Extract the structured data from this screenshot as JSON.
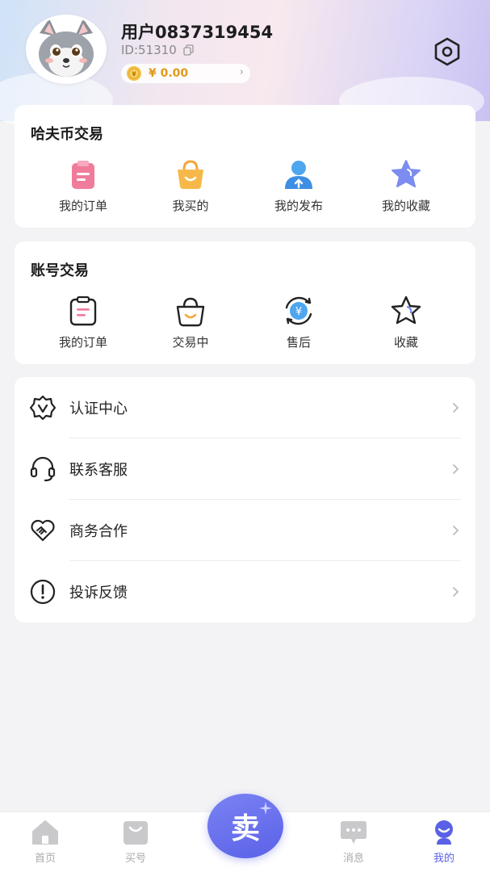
{
  "profile": {
    "username": "用户0837319454",
    "id_text": "ID:51310",
    "balance": "¥ 0.00"
  },
  "hafu_section": {
    "title": "哈夫币交易",
    "items": [
      {
        "label": "我的订单",
        "icon": "pink-clipboard-icon"
      },
      {
        "label": "我买的",
        "icon": "orange-bag-icon"
      },
      {
        "label": "我的发布",
        "icon": "blue-user-upload-icon"
      },
      {
        "label": "我的收藏",
        "icon": "purple-star-icon"
      }
    ]
  },
  "account_section": {
    "title": "账号交易",
    "items": [
      {
        "label": "我的订单",
        "icon": "clipboard-outline-icon"
      },
      {
        "label": "交易中",
        "icon": "basket-outline-icon"
      },
      {
        "label": "售后",
        "icon": "yuan-refresh-icon"
      },
      {
        "label": "收藏",
        "icon": "star-outline-icon"
      }
    ]
  },
  "menu": [
    {
      "label": "认证中心",
      "icon": "verified-badge-icon"
    },
    {
      "label": "联系客服",
      "icon": "headset-icon"
    },
    {
      "label": "商务合作",
      "icon": "heart-handshake-icon"
    },
    {
      "label": "投诉反馈",
      "icon": "exclamation-circle-icon"
    }
  ],
  "tabbar": {
    "tabs": [
      {
        "label": "首页",
        "icon": "home-icon"
      },
      {
        "label": "买号",
        "icon": "shopping-bag-icon"
      },
      {
        "label": "消息",
        "icon": "chat-icon"
      },
      {
        "label": "我的",
        "icon": "profile-icon"
      }
    ],
    "sell_label": "卖",
    "active_color": "#5a61e6"
  }
}
